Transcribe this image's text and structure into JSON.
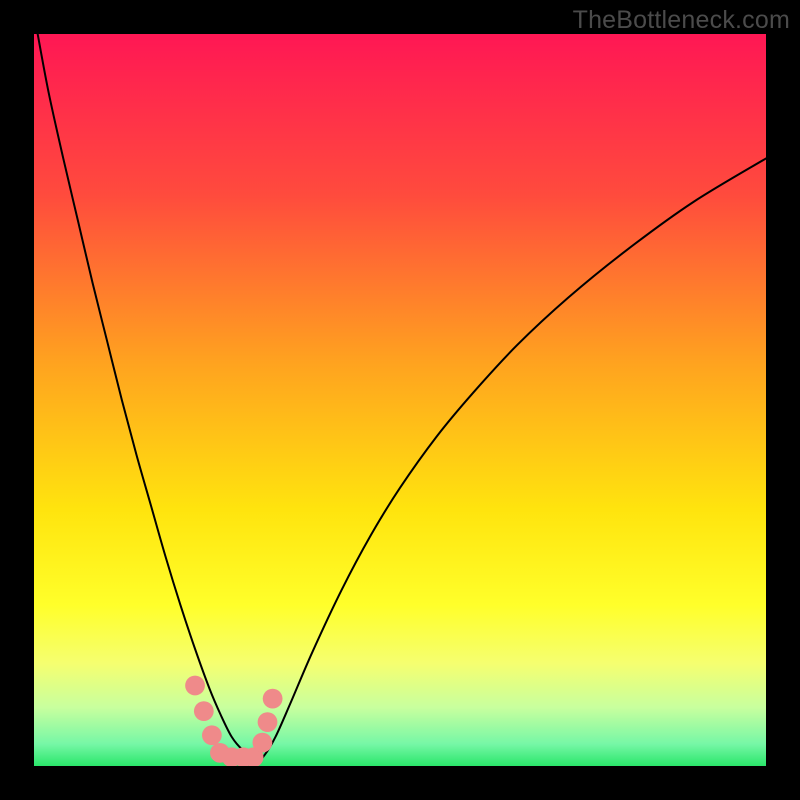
{
  "watermark": "TheBottleneck.com",
  "chart_data": {
    "type": "line",
    "title": "",
    "xlabel": "",
    "ylabel": "",
    "xlim": [
      0,
      100
    ],
    "ylim": [
      0,
      100
    ],
    "grid": false,
    "legend": false,
    "background_gradient": {
      "stops": [
        {
          "offset": 0.0,
          "color": "#ff1754"
        },
        {
          "offset": 0.22,
          "color": "#ff4b3d"
        },
        {
          "offset": 0.45,
          "color": "#ffa31f"
        },
        {
          "offset": 0.65,
          "color": "#ffe40e"
        },
        {
          "offset": 0.78,
          "color": "#ffff2a"
        },
        {
          "offset": 0.86,
          "color": "#f5ff70"
        },
        {
          "offset": 0.92,
          "color": "#c8ff9e"
        },
        {
          "offset": 0.97,
          "color": "#76f7a6"
        },
        {
          "offset": 1.0,
          "color": "#2ae66a"
        }
      ]
    },
    "series": [
      {
        "name": "bottleneck-curve",
        "color": "#000000",
        "stroke_width": 2,
        "x": [
          0.5,
          2,
          4,
          6,
          8,
          10,
          12,
          14,
          16,
          18,
          20,
          22,
          24,
          25.5,
          27,
          28.5,
          30.5,
          31.5,
          33,
          35,
          38,
          42,
          46,
          50,
          55,
          60,
          66,
          73,
          81,
          90,
          100
        ],
        "y": [
          100,
          92,
          83,
          74.5,
          66,
          58,
          50,
          42.5,
          35.5,
          28.5,
          22,
          16,
          10.5,
          7,
          4,
          2.2,
          0.8,
          1.5,
          4,
          8.5,
          15.5,
          24,
          31.5,
          38,
          45,
          51,
          57.5,
          64,
          70.5,
          77,
          83
        ]
      }
    ],
    "markers": {
      "color": "#ef8a8a",
      "radius_frac": 0.0135,
      "points_xy": [
        [
          22.0,
          11.0
        ],
        [
          23.2,
          7.5
        ],
        [
          24.3,
          4.2
        ],
        [
          25.4,
          1.8
        ],
        [
          27.0,
          1.2
        ],
        [
          28.6,
          1.2
        ],
        [
          30.0,
          1.2
        ],
        [
          31.2,
          3.2
        ],
        [
          31.9,
          6.0
        ],
        [
          32.6,
          9.2
        ]
      ]
    }
  }
}
